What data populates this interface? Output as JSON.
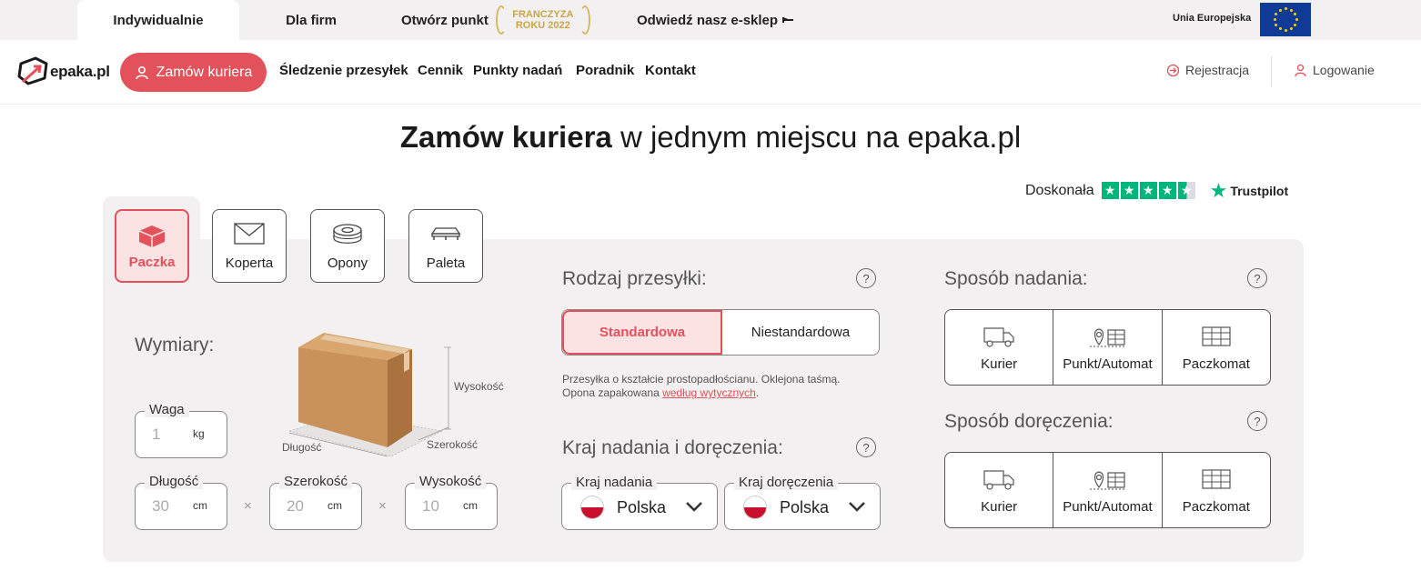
{
  "topbar": {
    "tabs": [
      "Indywidualnie",
      "Dla firm",
      "Otwórz punkt",
      "Odwiedź nasz e-sklep"
    ],
    "badge_line1": "FRANCZYZA",
    "badge_line2": "ROKU 2022",
    "eu_label": "Unia Europejska"
  },
  "nav": {
    "logo_text": "epaka.pl",
    "order_button": "Zamów kuriera",
    "links": [
      "Śledzenie przesyłek",
      "Cennik",
      "Punkty nadań",
      "Poradnik",
      "Kontakt"
    ],
    "register": "Rejestracja",
    "login": "Logowanie"
  },
  "headline": {
    "bold": "Zamów kuriera",
    "rest": "w jednym miejscu na epaka.pl"
  },
  "trustpilot": {
    "rating_text": "Doskonała",
    "brand": "Trustpilot",
    "stars": 4.5
  },
  "package_types": [
    "Paczka",
    "Koperta",
    "Opony",
    "Paleta"
  ],
  "dimensions": {
    "title": "Wymiary:",
    "illustration_labels": {
      "height": "Wysokość",
      "length": "Długość",
      "width": "Szerokość"
    },
    "weight": {
      "label": "Waga",
      "value": "1",
      "unit": "kg"
    },
    "length": {
      "label": "Długość",
      "value": "30",
      "unit": "cm"
    },
    "width": {
      "label": "Szerokość",
      "value": "20",
      "unit": "cm"
    },
    "height": {
      "label": "Wysokość",
      "value": "10",
      "unit": "cm"
    },
    "times": "×"
  },
  "shipment_type": {
    "title": "Rodzaj przesyłki:",
    "help": "?",
    "options": [
      "Standardowa",
      "Niestandardowa"
    ],
    "desc_line1": "Przesyłka o kształcie prostopadłościanu. Oklejona taśmą.",
    "desc_line2_start": "Opona zapakowana ",
    "desc_link": "według wytycznych",
    "desc_line2_end": "."
  },
  "countries": {
    "title": "Kraj nadania i doręczenia:",
    "help": "?",
    "from_label": "Kraj nadania",
    "from_value": "Polska",
    "to_label": "Kraj doręczenia",
    "to_value": "Polska"
  },
  "sending_method": {
    "title": "Sposób nadania:",
    "help": "?",
    "options": [
      "Kurier",
      "Punkt/Automat",
      "Paczkomat"
    ]
  },
  "delivery_method": {
    "title": "Sposób doręczenia:",
    "help": "?",
    "options": [
      "Kurier",
      "Punkt/Automat",
      "Paczkomat"
    ]
  },
  "colors": {
    "accent": "#e3515a",
    "panel": "#f2f0f0",
    "trustpilot": "#00b67a",
    "eu_blue": "#0f3a96"
  }
}
